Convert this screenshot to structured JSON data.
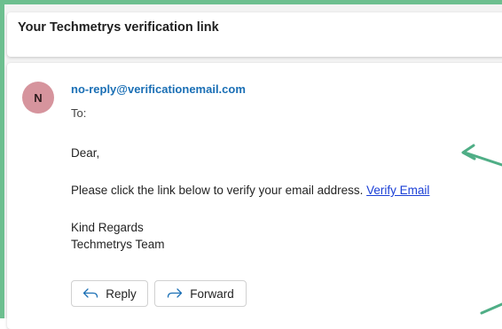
{
  "email": {
    "subject": "Your Techmetrys verification link",
    "sender": {
      "avatar_initial": "N",
      "address": "no-reply@verificationemail.com"
    },
    "to_label": "To:",
    "body": {
      "greeting": "Dear,",
      "instruction": "Please click the link below to verify your email address. ",
      "link_text": "Verify Email",
      "closing_line1": "Kind Regards",
      "closing_line2": "Techmetrys Team"
    },
    "actions": {
      "reply_label": "Reply",
      "forward_label": "Forward"
    }
  },
  "colors": {
    "frame_accent": "#6dbf8f",
    "avatar_bg": "#d6949d",
    "sender_text": "#1a6fb5",
    "link": "#1a3fd6",
    "action_icon": "#1a6fb5"
  }
}
